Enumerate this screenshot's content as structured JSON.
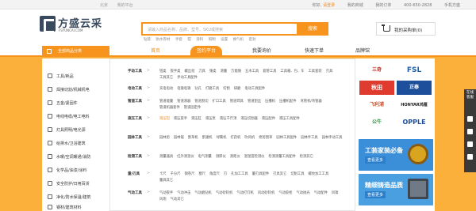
{
  "topbar": {
    "left": [
      "北京",
      "我的平台"
    ],
    "greeting": "你好,",
    "login": "请登录",
    "right": [
      "我的商城",
      "我的订单",
      "400-650-2828",
      "手机方盛"
    ]
  },
  "logo": {
    "name": "方盛云采",
    "sub": "FSYUNCAI.COM"
  },
  "search": {
    "placeholder": "请输入商品名称、品牌、型号、SKU或搜索",
    "button": "搜索"
  },
  "hotwords": [
    "钻管",
    "防水卷材",
    "手套",
    "钳",
    "漆料",
    "照明",
    "设置",
    "换气机",
    "密封"
  ],
  "cart": {
    "label": "我的采购单(0)"
  },
  "nav": {
    "allcat": "全部商品分类",
    "items": [
      "首页",
      "签约平台",
      "我要询价",
      "快速下单",
      "品牌馆"
    ]
  },
  "categories": [
    "工具/耗品",
    "焊接切割/机械机电",
    "五金/紧固件",
    "电线电缆/电工电料",
    "灯具照明/电光源",
    "给排水/卫浴建筑",
    "水暖/空调暖通/消防",
    "化学品/油漆/涂料",
    "安全防护/日用百货",
    "净化/防水保温/建筑",
    "钢材/建筑材料"
  ],
  "submenu": [
    {
      "head": "手动工具",
      "items": [
        "钳类",
        "扳手类",
        "螺丝批",
        "刀具",
        "锤类",
        "测量",
        "万能锤",
        "五木工具",
        "套管工具",
        "工具箱、包、车",
        "工具套装",
        "刃具",
        "工具其它",
        "手动工具配件"
      ]
    },
    {
      "head": "电动工具",
      "items": [
        "充电电动",
        "电锤电镐",
        "钻孔",
        "打磨工具",
        "切割",
        "研磨",
        "电动工具配件"
      ]
    },
    {
      "head": "管道工具",
      "items": [
        "管道能量",
        "管道清器",
        "管道割切",
        "扩口工具",
        "管道焊具",
        "管道割丝",
        "压槽机",
        "压槽机配件",
        "弯管机/弯管器",
        "管道机器套件",
        "管道固定件"
      ]
    },
    {
      "head": "液压工具",
      "items": [
        "液压钳",
        "液压扳手",
        "液压缸",
        "液压泵",
        "液压千斤顶",
        "液压切割器",
        "液压配件",
        "液压工具配件"
      ],
      "hl": 0
    },
    {
      "head": "园林工具",
      "items": [
        "园林剪",
        "园林锯",
        "割草机",
        "割灌机",
        "绿篱机",
        "打药机",
        "吹风机",
        "修剪割草",
        "园林工具配件",
        "园林手工具",
        "园林手动工具"
      ]
    },
    {
      "head": "检测工具",
      "items": [
        "测量器具",
        "红外测温仪",
        "电气测量",
        "测厚仪",
        "测距仪",
        "温湿度检测仪",
        "检测测量工具配件",
        "检测其它"
      ]
    },
    {
      "head": "量/刃具",
      "items": [
        "卡尺",
        "千分尺",
        "钢卷尺",
        "塞尺",
        "角度尺",
        "刃",
        "孔加工工具",
        "量刃具配件",
        "刃具其它",
        "切削工具",
        "螺纹加工工具",
        "量具其它"
      ]
    },
    {
      "head": "气动工具",
      "items": [
        "气动扳手",
        "气动冲击",
        "气动磨钻机",
        "气动砂轮机",
        "气动打钉机",
        "风动砂轮机",
        "气动胶枪",
        "气动抛光",
        "气动配件",
        "风镐",
        "风炮",
        "气动其它"
      ]
    }
  ],
  "brands": [
    "三奇",
    "FSL",
    "秋田",
    "正泰",
    "飞利浦",
    "HONYAR鸿雁",
    "公牛",
    "OPPLE"
  ],
  "banners": [
    {
      "title": "工装家装必备",
      "tag": "查看更多"
    },
    {
      "title": "精细铸造品质",
      "tag": "查看更多"
    }
  ],
  "float": {
    "label": "在线客服"
  },
  "colors": {
    "accent": "#f7941d",
    "dark": "#3a4a5e",
    "banner": "#fbb03b"
  }
}
